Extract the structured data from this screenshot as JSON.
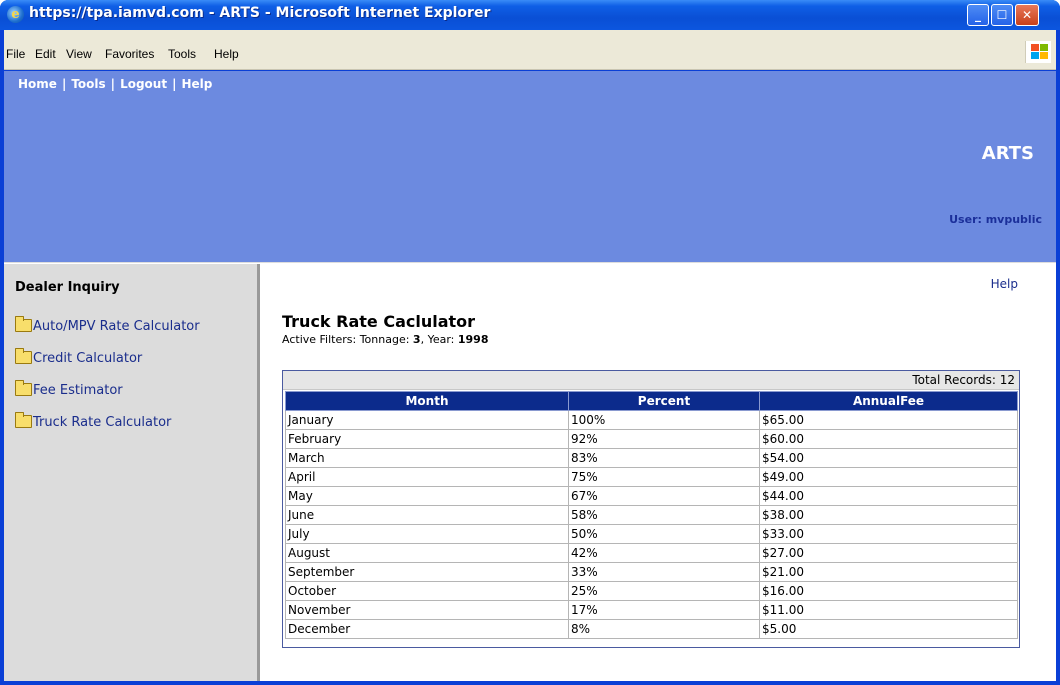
{
  "window": {
    "title": "https://tpa.iamvd.com - ARTS - Microsoft Internet Explorer",
    "menu": [
      "File",
      "Edit",
      "View",
      "Favorites",
      "Tools",
      "Help"
    ],
    "icon": "internet-explorer-icon"
  },
  "topnav": {
    "home": "Home",
    "tools": "Tools",
    "logout": "Logout",
    "help": "Help",
    "separator": "|"
  },
  "banner": {
    "app_name": "ARTS",
    "user_label": "User: mvpublic",
    "color": "#6c8ae0"
  },
  "sidebar": {
    "title": "Dealer Inquiry",
    "items": [
      {
        "label": "Auto/MPV Rate Calculator",
        "icon": "folder-icon"
      },
      {
        "label": "Credit Calculator",
        "icon": "folder-icon"
      },
      {
        "label": "Fee Estimator",
        "icon": "folder-icon"
      },
      {
        "label": "Truck Rate Calculator",
        "icon": "folder-icon"
      }
    ]
  },
  "main": {
    "help_link": "Help",
    "title": "Truck Rate Caclulator",
    "filters": {
      "prefix": "Active Filters: Tonnage: ",
      "tonnage": "3",
      "middle": ", Year: ",
      "year": "1998"
    },
    "total_records": "Total Records: 12",
    "columns": [
      "Month",
      "Percent",
      "AnnualFee"
    ],
    "rows": [
      [
        "January",
        "100%",
        "$65.00"
      ],
      [
        "February",
        "92%",
        "$60.00"
      ],
      [
        "March",
        "83%",
        "$54.00"
      ],
      [
        "April",
        "75%",
        "$49.00"
      ],
      [
        "May",
        "67%",
        "$44.00"
      ],
      [
        "June",
        "58%",
        "$38.00"
      ],
      [
        "July",
        "50%",
        "$33.00"
      ],
      [
        "August",
        "42%",
        "$27.00"
      ],
      [
        "September",
        "33%",
        "$21.00"
      ],
      [
        "October",
        "25%",
        "$16.00"
      ],
      [
        "November",
        "17%",
        "$11.00"
      ],
      [
        "December",
        "8%",
        "$5.00"
      ]
    ],
    "header_color": "#0c2b8c"
  }
}
